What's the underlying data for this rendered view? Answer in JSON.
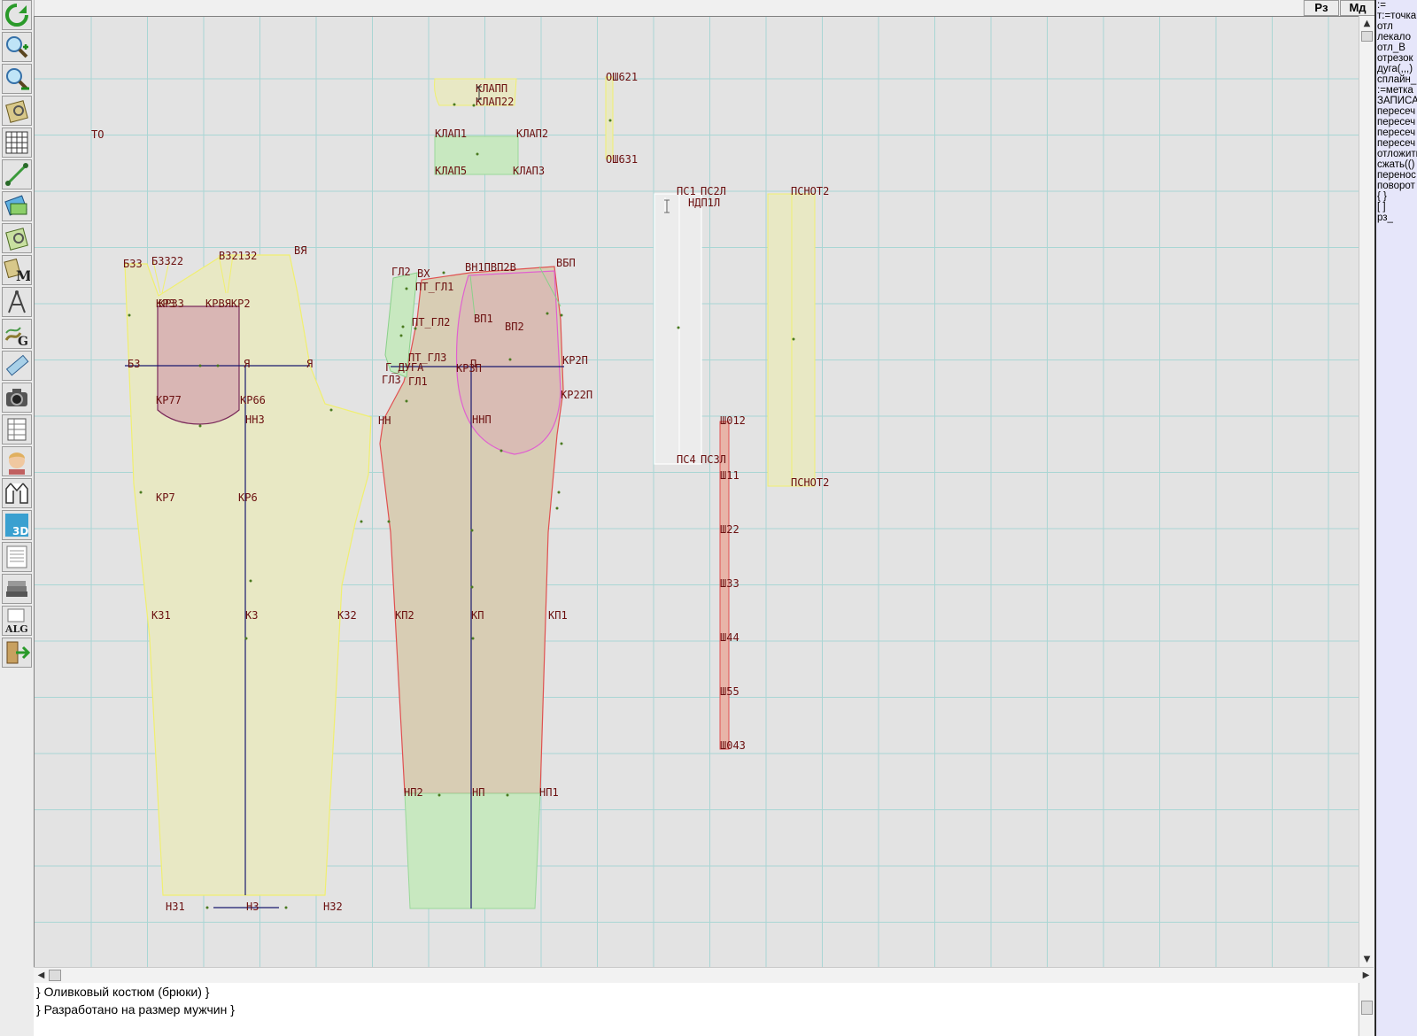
{
  "toolbar": {
    "tools": [
      {
        "icon": "refresh-icon"
      },
      {
        "icon": "zoom-in-icon"
      },
      {
        "icon": "zoom-out-icon"
      },
      {
        "icon": "zoom-pattern-icon"
      },
      {
        "icon": "grid-icon"
      },
      {
        "icon": "line-tool-icon"
      },
      {
        "icon": "layers-icon"
      },
      {
        "icon": "pattern-zoom-icon"
      },
      {
        "icon": "measurements-icon"
      },
      {
        "icon": "compass-icon"
      },
      {
        "icon": "graduation-icon"
      },
      {
        "icon": "ruler-icon"
      },
      {
        "icon": "camera-icon"
      },
      {
        "icon": "table-icon"
      },
      {
        "icon": "person-icon"
      },
      {
        "icon": "jacket-icon"
      },
      {
        "icon": "3d-icon"
      },
      {
        "icon": "document-icon"
      },
      {
        "icon": "books-icon"
      },
      {
        "icon": "algorithm-icon"
      },
      {
        "icon": "exit-icon"
      }
    ]
  },
  "top_buttons": {
    "rz": "Рз",
    "md": "Мд"
  },
  "command_panel": {
    "commands": [
      ":=",
      "т:=точка",
      "отл",
      "лекало",
      "отл_В",
      "отрезок",
      "дуга(,,,)",
      "сплайн_",
      ":=метка",
      "ЗАПИСАТЬ",
      "пересеч",
      "пересеч",
      "пересеч",
      "пересеч",
      "отложить",
      "сжать(()",
      "перенос",
      "поворот",
      "{ }",
      "[ ]",
      "рз_"
    ]
  },
  "notes": {
    "line1": "} Оливковый костюм (брюки) }",
    "line2": "} Разработано на размер мужчин  }"
  },
  "colors": {
    "canvas_bg": "#e3e3e3",
    "grid": "#a9d6d4",
    "yellow_piece": "#e8e8c4",
    "red_piece": "#d8cdb4",
    "pink_piece": "#d9b6b4",
    "green_piece": "#c8e8c0",
    "label": "#6b1010"
  },
  "canvas": {
    "labels": {
      "to": "ТО",
      "klapp": "КЛАПП",
      "klap22": "КЛАП22",
      "klap1": "КЛАП1",
      "klap2": "КЛАП2",
      "klap5": "КЛАП5",
      "klap3": "КЛАП3",
      "tsh21": "ОШ621",
      "tsh31": "ОШ631",
      "ps1": "ПС1",
      "ps2": "ПС2Л",
      "ndp1": "НДП1Л",
      "ps4": "ПС4",
      "ps3": "ПС3Л",
      "pt1": "ПСНОТ2",
      "pt2": "ПСНОТ2",
      "bz3": "БЗЗ",
      "bz2": "БЗЗ22",
      "bz32": "ВЗ2132",
      "vya": "ВЯ",
      "kr3": "КР3",
      "kr33": "КР33",
      "krp": "КРВЯКР2",
      "bz": "БЗ",
      "ya": "Я",
      "ya2": "Я",
      "kr77": "КР77",
      "kr66": "КР66",
      "nn3": "НН3",
      "kr7": "КР7",
      "kr6": "КР6",
      "k31": "К31",
      "k3": "К3",
      "k32": "К32",
      "n31": "Н31",
      "n3": "Н3",
      "n32": "Н32",
      "gl2": "ГЛ2",
      "vx": "ВХ",
      "vtop": "ВН1ПВП2В",
      "vbp": "ВБП",
      "pt_gl1": "ПТ_ГЛ1",
      "pt_gl2": "ПТ_ГЛ2",
      "pt_gl3": "ПТ_ГЛ3",
      "vp1": "ВП1",
      "vp2": "ВП2",
      "g_dl": "Г_ДУГА",
      "gl3": "ГЛ3",
      "gl1": "ГЛ1",
      "kr3p": "КР3П",
      "p": "П",
      "kr2p": "КР2П",
      "kr22p": "КР22П",
      "nn": "НН",
      "nnp": "ННП",
      "kp2": "КП2",
      "kp": "КП",
      "kp1": "КП1",
      "np2": "НП2",
      "np": "НП",
      "np1": "НП1",
      "sh0": "Ш012",
      "sh1": "Ш11",
      "sh2": "Ш22",
      "sh3": "Ш33",
      "sh4": "Ш44",
      "sh5": "Ш55",
      "sh6": "Ш043"
    }
  }
}
